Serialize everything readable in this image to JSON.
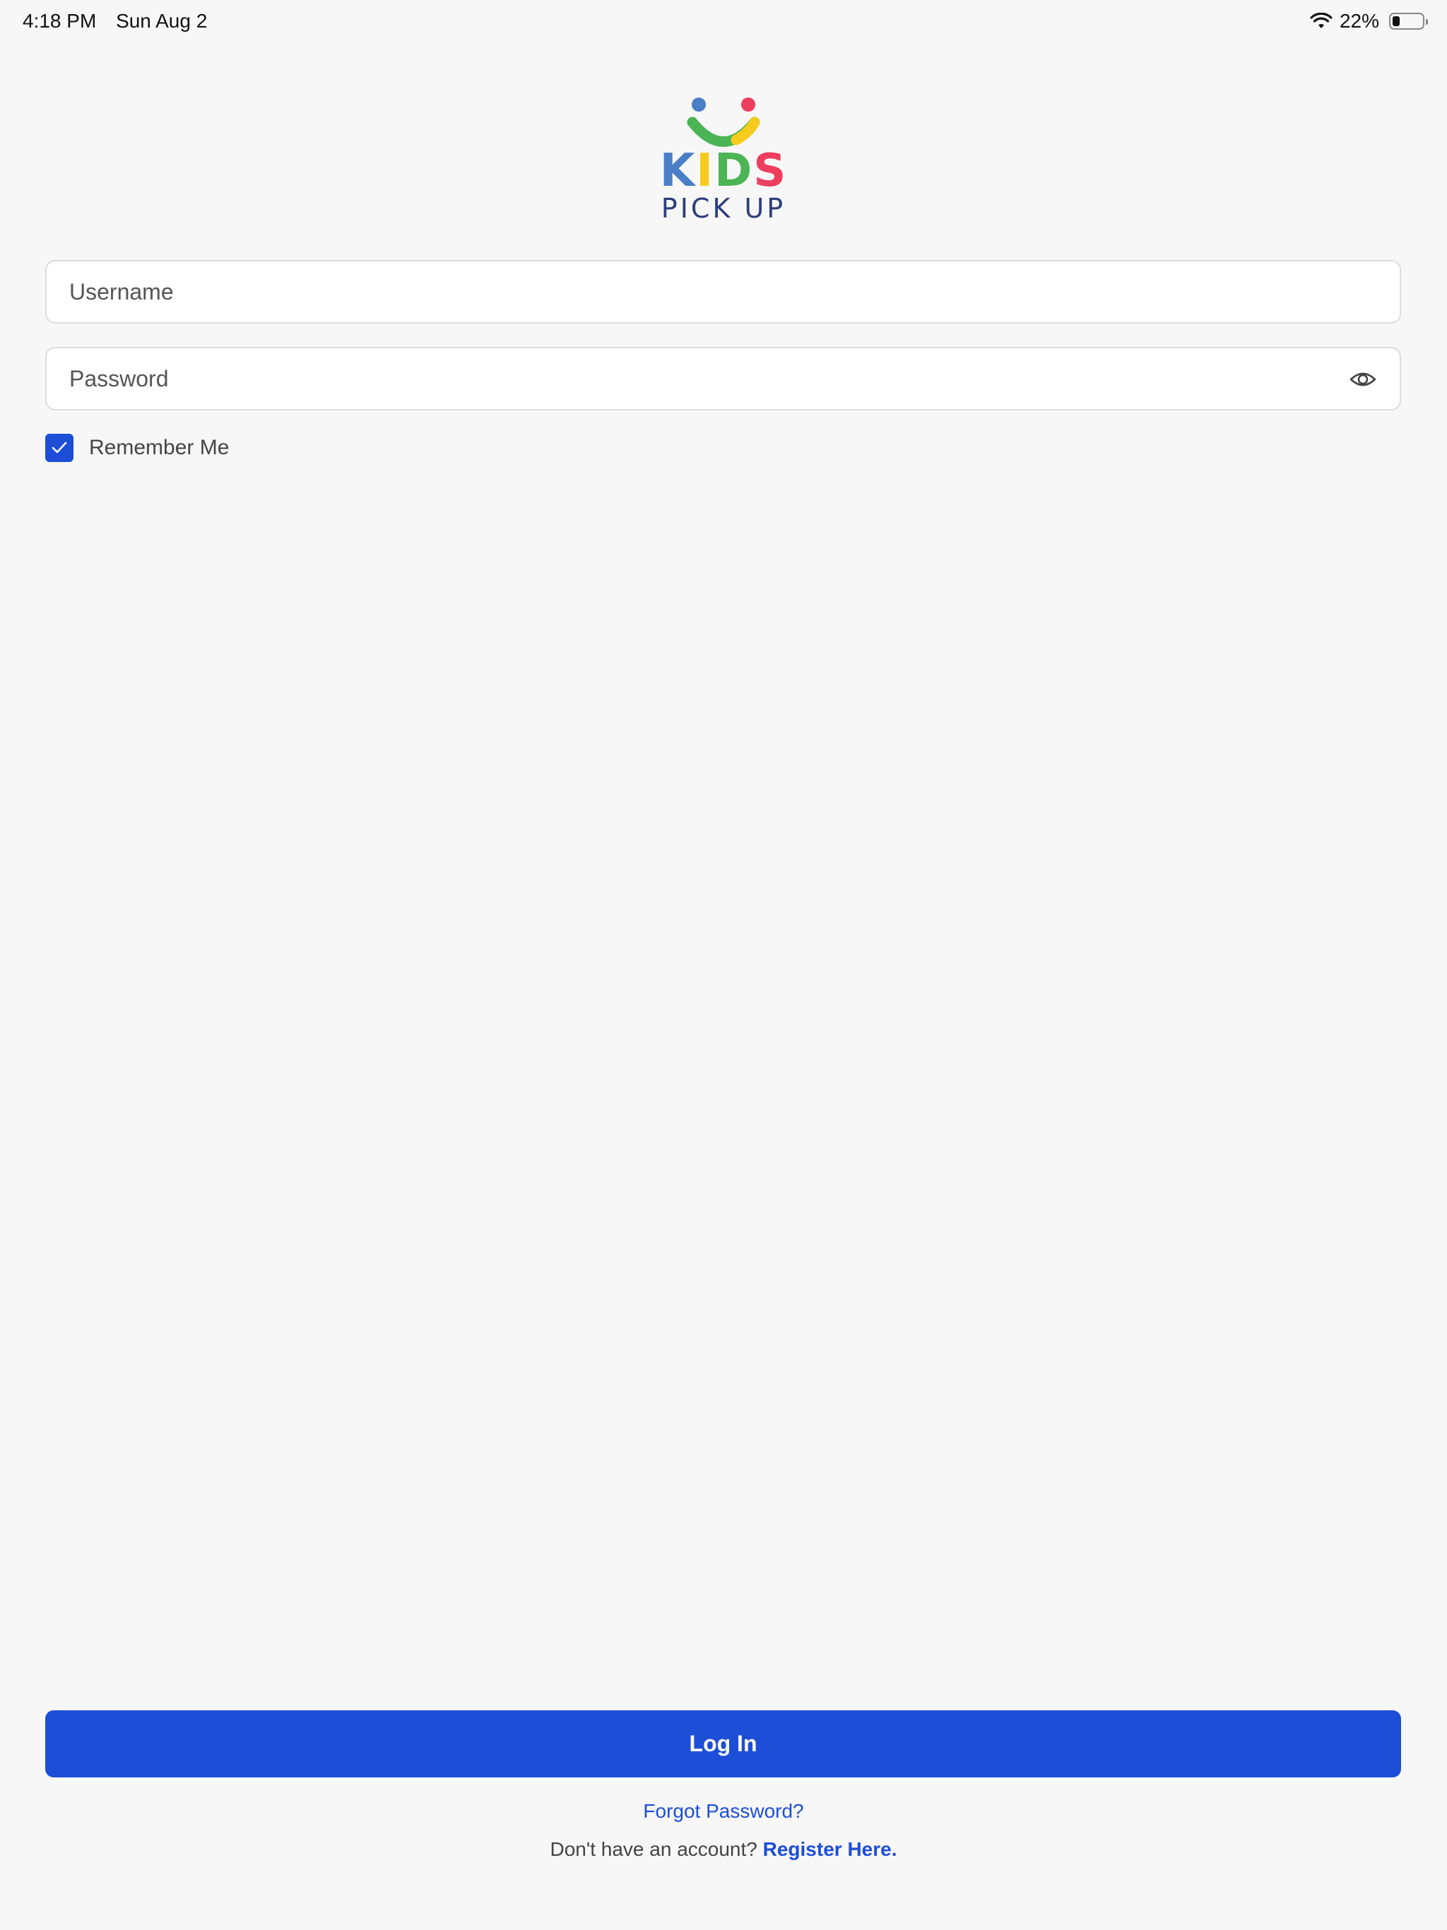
{
  "status_bar": {
    "time": "4:18 PM",
    "date": "Sun Aug 2",
    "battery_percent": "22%",
    "battery_level": 0.22
  },
  "logo": {
    "word_top": "KIDS",
    "letters": [
      "K",
      "I",
      "D",
      "S"
    ],
    "word_bottom": "PICK UP",
    "colors": {
      "blue": "#4a7fc7",
      "yellow": "#f6cb1c",
      "green": "#4bb454",
      "red": "#ee3e5f",
      "navy": "#2c3e7c"
    }
  },
  "form": {
    "username_placeholder": "Username",
    "username_value": "",
    "password_placeholder": "Password",
    "password_value": "",
    "password_toggle_icon": "eye-icon",
    "remember_me_label": "Remember Me",
    "remember_me_checked": true
  },
  "actions": {
    "login_label": "Log In",
    "forgot_password_label": "Forgot Password?",
    "register_prompt": "Don't have an account?",
    "register_link_label": "Register Here."
  },
  "theme": {
    "accent": "#1d4ed8",
    "background": "#f7f7f7"
  }
}
